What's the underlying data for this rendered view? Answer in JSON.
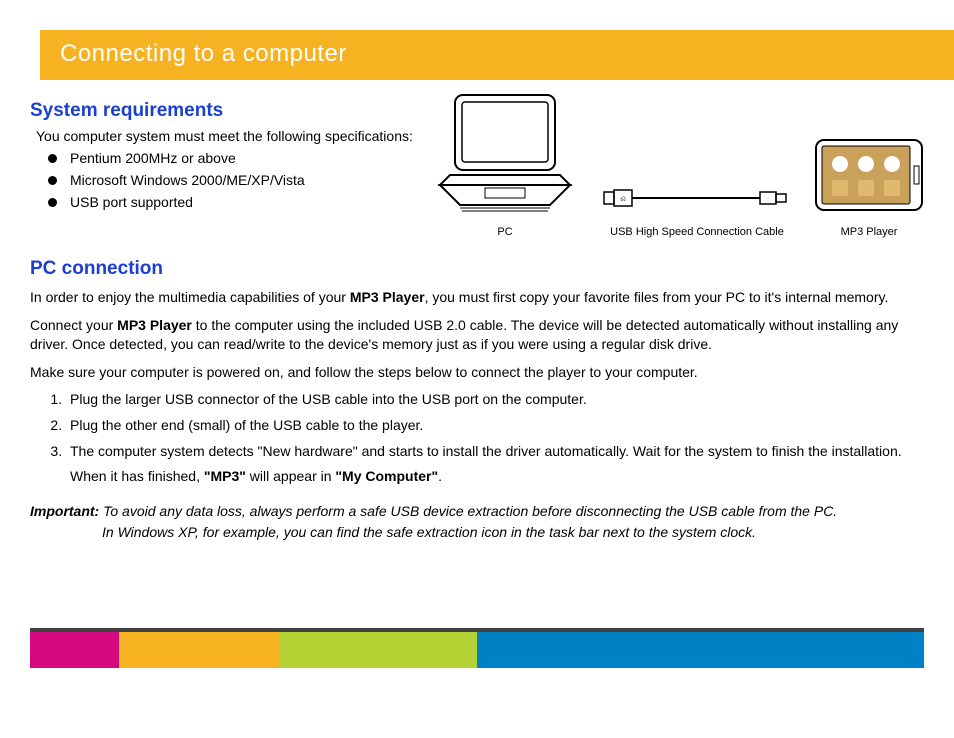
{
  "title": "Connecting to a computer",
  "sysreq": {
    "heading": "System requirements",
    "intro": "You computer system must meet the following specifications:",
    "items": [
      "Pentium 200MHz or above",
      "Microsoft Windows 2000/ME/XP/Vista",
      "USB port supported"
    ]
  },
  "diagram": {
    "pc": "PC",
    "cable": "USB High Speed Connection Cable",
    "mp3": "MP3 Player"
  },
  "pcconn": {
    "heading": "PC connection",
    "p1a": "In order to enjoy the multimedia capabilities of your ",
    "p1b": "MP3 Player",
    "p1c": ", you must first copy your favorite files from your PC to it's internal memory.",
    "p2a": "Connect your ",
    "p2b": "MP3 Player",
    "p2c": " to the computer using the included USB 2.0 cable.  The device will be detected automatically without installing any driver. Once detected, you can read/write to the device's memory just as if you were using a regular disk drive.",
    "p3": "Make  sure  your  computer  is  powered  on, and follow the steps below to connect the player to your computer.",
    "steps": [
      "Plug the larger USB connector of the USB cable into the USB port on the computer.",
      "Plug the other end (small) of the USB cable to the player.",
      "The computer system detects \"New hardware\" and starts to install the driver automatically. Wait for the system to finish the installation."
    ],
    "step3_sub_a": "When it has finished,  ",
    "step3_sub_b": "\"MP3\"",
    "step3_sub_c": "  will appear  in ",
    "step3_sub_d": "\"My Computer\"",
    "step3_sub_e": "."
  },
  "important": {
    "label": "Important:",
    "l1": " To avoid any data loss, always perform a safe USB device extraction before disconnecting the USB cable from the PC.",
    "l2": "In Windows XP, for example, you can find the safe extraction icon in the task bar next to the system clock."
  }
}
